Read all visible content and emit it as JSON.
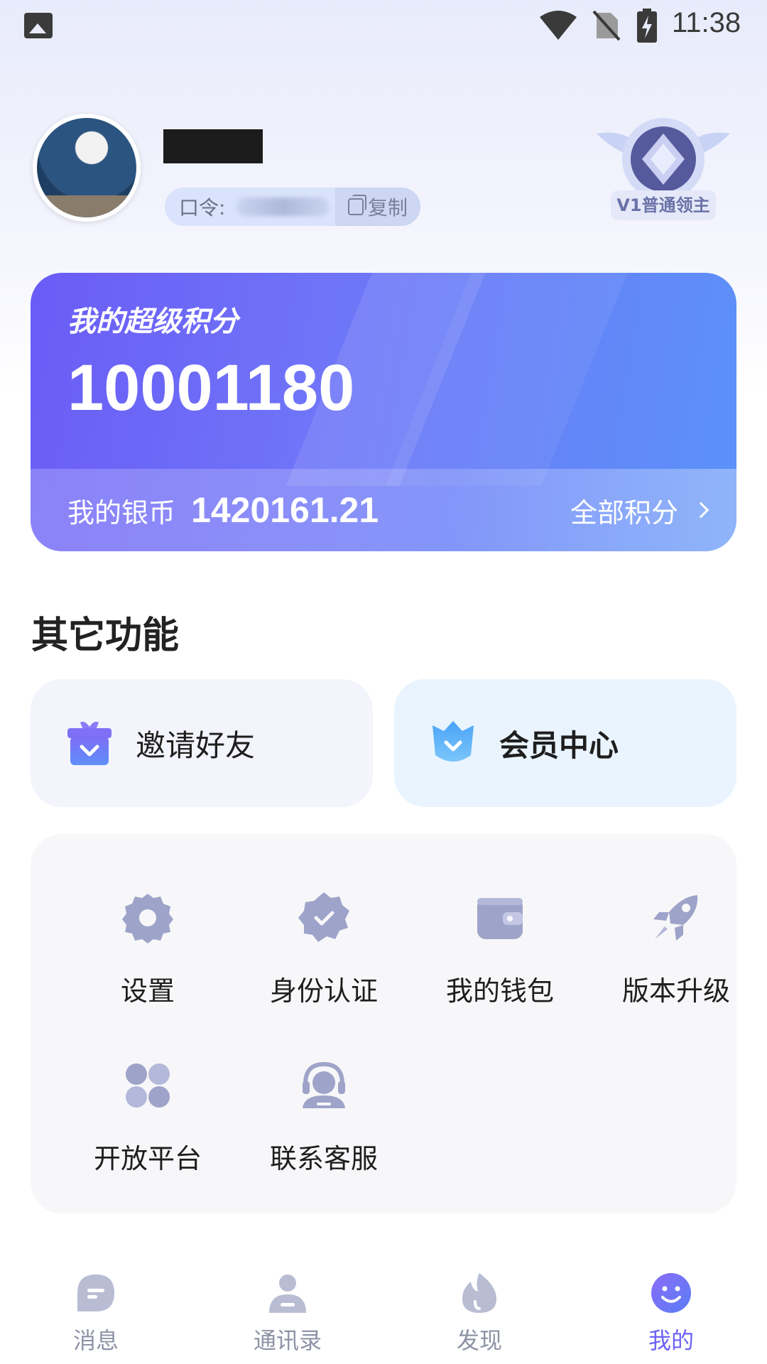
{
  "status_bar": {
    "time": "11:38"
  },
  "profile": {
    "code_label": "口令:",
    "copy_label": "复制",
    "level": "V1普通领主"
  },
  "points_card": {
    "title": "我的超级积分",
    "value": "10001180",
    "silver_label": "我的银币",
    "silver_value": "1420161.21",
    "all_points": "全部积分"
  },
  "section": {
    "title": "其它功能"
  },
  "cards": {
    "invite": "邀请好友",
    "vip": "会员中心"
  },
  "grid": {
    "items": [
      {
        "label": "设置",
        "icon": "gear-icon"
      },
      {
        "label": "身份认证",
        "icon": "verified-badge-icon"
      },
      {
        "label": "我的钱包",
        "icon": "wallet-icon"
      },
      {
        "label": "版本升级",
        "icon": "rocket-icon"
      },
      {
        "label": "开放平台",
        "icon": "apps-grid-icon"
      },
      {
        "label": "联系客服",
        "icon": "headset-icon"
      }
    ]
  },
  "tabs": [
    {
      "label": "消息",
      "icon": "chat-icon",
      "active": false
    },
    {
      "label": "通讯录",
      "icon": "contacts-icon",
      "active": false
    },
    {
      "label": "发现",
      "icon": "flame-icon",
      "active": false
    },
    {
      "label": "我的",
      "icon": "smile-icon",
      "active": true
    }
  ],
  "colors": {
    "accent": "#6c63f5",
    "card_start": "#6a5cf6",
    "card_end": "#5b92f8",
    "icon_gray": "#9ea3c4"
  }
}
